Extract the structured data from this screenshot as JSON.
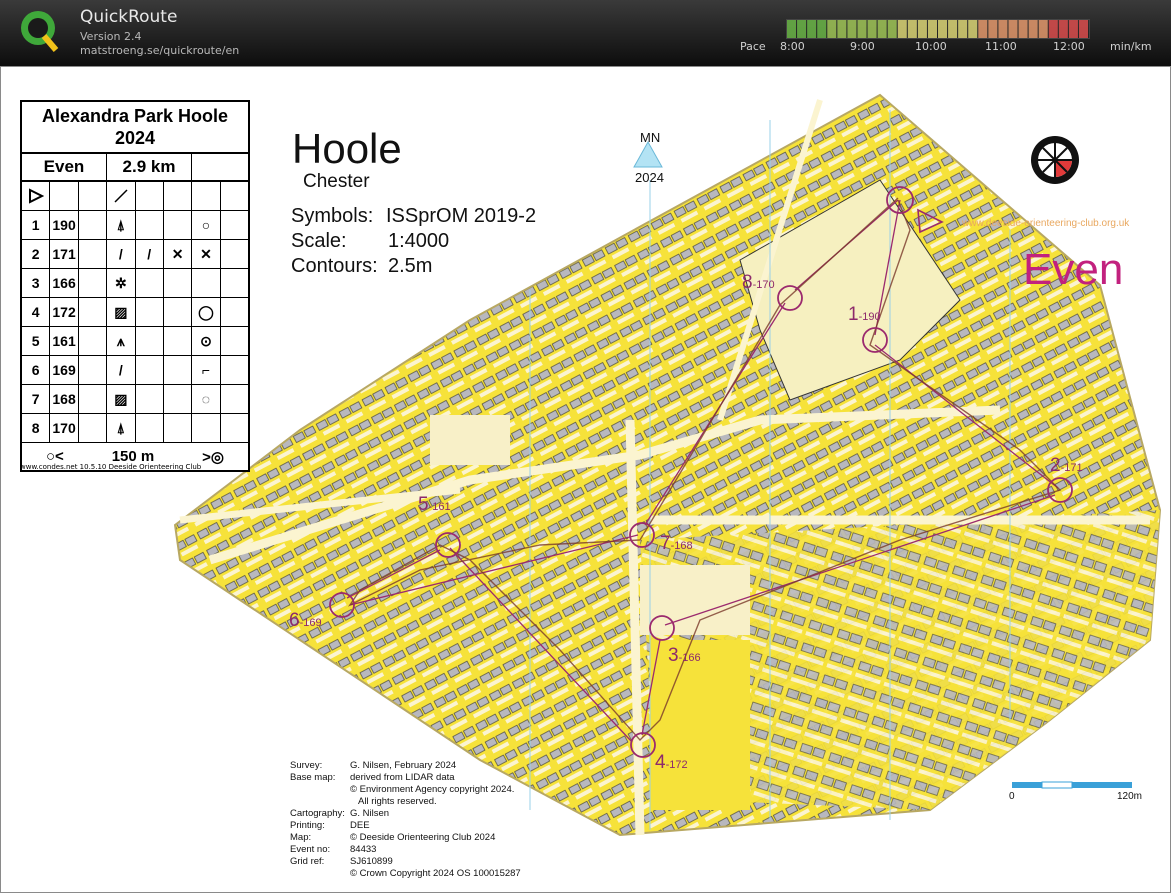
{
  "app": {
    "title": "QuickRoute",
    "version": "Version 2.4",
    "url": "matstroeng.se/quickroute/en",
    "logo_letter": "Q"
  },
  "pace": {
    "label": "Pace",
    "ticks": [
      "8:00",
      "9:00",
      "10:00",
      "11:00",
      "12:00"
    ],
    "unit": "min/km",
    "colors": [
      "#6fbf4a",
      "#a7d05a",
      "#e6e07a",
      "#f0a070",
      "#e65050"
    ]
  },
  "control_card": {
    "event": "Alexandra Park Hoole 2024",
    "course": "Even",
    "length": "2.9 km",
    "start_symbol": "start-triangle",
    "rows": [
      {
        "num": "1",
        "code": "190",
        "feature": "tree-symbol",
        "where": "circle-symbol"
      },
      {
        "num": "2",
        "code": "171",
        "feature": "slash-symbol",
        "where": "x-symbol"
      },
      {
        "num": "3",
        "code": "166",
        "feature": "thicket-symbol",
        "where": ""
      },
      {
        "num": "4",
        "code": "172",
        "feature": "hatched-square-symbol",
        "where": "q-circle-symbol"
      },
      {
        "num": "5",
        "code": "161",
        "feature": "tree-group-symbol",
        "where": "dot-circle-symbol"
      },
      {
        "num": "6",
        "code": "169",
        "feature": "slash-symbol",
        "where": "corner-symbol"
      },
      {
        "num": "7",
        "code": "168",
        "feature": "hatched-square-symbol",
        "where": "c-circle-symbol"
      },
      {
        "num": "8",
        "code": "170",
        "feature": "tree-symbol",
        "where": ""
      }
    ],
    "finish_distance": "150 m",
    "software_note": "www.condes.net 10.5.10 Deeside Orienteering Club"
  },
  "map": {
    "title": "Hoole",
    "subtitle": "Chester",
    "symbols_label": "Symbols:",
    "symbols_value": "ISSprOM 2019-2",
    "scale_label": "Scale:",
    "scale_value": "1:4000",
    "contours_label": "Contours:",
    "contours_value": "2.5m",
    "north_label": "MN",
    "north_year": "2024",
    "course_name": "Even",
    "club_name": "DEESIDE ORIENTEERING CLUB",
    "club_url": "www.deeside-orienteering-club.org.uk",
    "scalebar_start": "0",
    "scalebar_end": "120m",
    "colors": {
      "open_land": "#f6e23a",
      "building": "#b8b8be",
      "course": "#9b2a6e",
      "route": "#7a3a2a"
    },
    "controls": [
      {
        "num": "1",
        "code": "-190"
      },
      {
        "num": "2",
        "code": "-171"
      },
      {
        "num": "3",
        "code": "-166"
      },
      {
        "num": "4",
        "code": "-172"
      },
      {
        "num": "5",
        "code": "-161"
      },
      {
        "num": "6",
        "code": "-169"
      },
      {
        "num": "7",
        "code": "-168"
      },
      {
        "num": "8",
        "code": "-170"
      }
    ]
  },
  "footer": {
    "survey_label": "Survey:",
    "survey_value": "G. Nilsen, February 2024",
    "basemap_label": "Base map:",
    "basemap_value": "derived from LIDAR data",
    "basemap_copy1": "© Environment Agency copyright 2024.",
    "basemap_copy2": "All rights reserved.",
    "cartography_label": "Cartography:",
    "cartography_value": "G. Nilsen",
    "printing_label": "Printing:",
    "printing_value": "DEE",
    "map_label": "Map:",
    "map_value": "© Deeside Orienteering Club 2024",
    "event_label": "Event no:",
    "event_value": "84433",
    "grid_label": "Grid ref:",
    "grid_value": "SJ610899",
    "crown": "© Crown Copyright 2024 OS 100015287"
  }
}
